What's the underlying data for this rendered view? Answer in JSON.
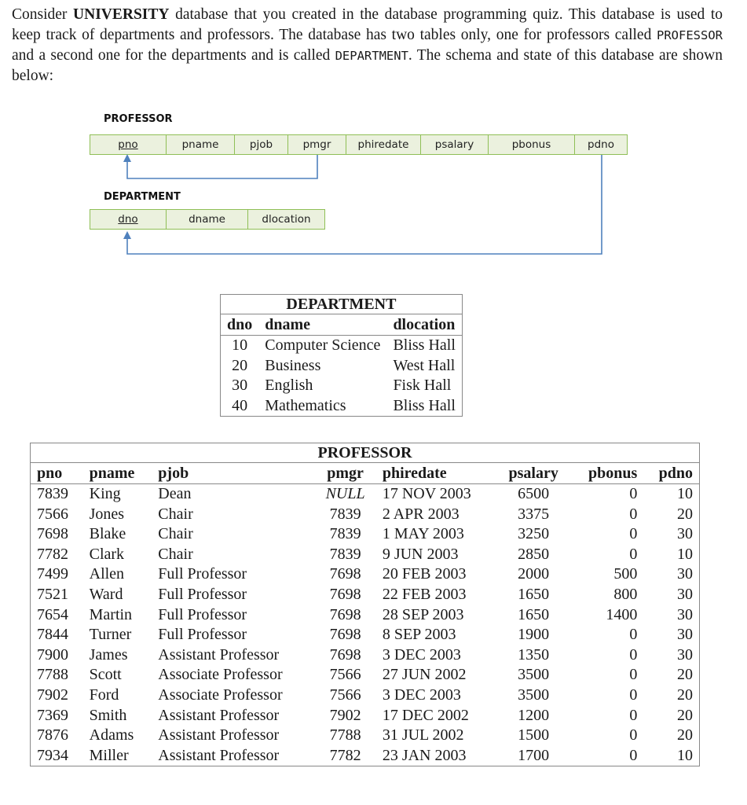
{
  "intro": {
    "p1": "Consider ",
    "db_name": "UNIVERSITY",
    "p2": " database that you created in the database programming quiz. This database is used to keep track of departments and professors. The database has two tables only, one for professors called ",
    "tbl1": "PROFESSOR",
    "p3": " and a second one for the departments and is called ",
    "tbl2": "DEPARTMENT",
    "p4": ". The schema and state of this database are shown below:"
  },
  "schema": {
    "professor": {
      "label": "PROFESSOR",
      "attributes": [
        "pno",
        "pname",
        "pjob",
        "pmgr",
        "phiredate",
        "psalary",
        "pbonus",
        "pdno"
      ],
      "primary_key": "pno"
    },
    "department": {
      "label": "DEPARTMENT",
      "attributes": [
        "dno",
        "dname",
        "dlocation"
      ],
      "primary_key": "dno"
    },
    "foreign_keys": [
      {
        "from": "PROFESSOR.pmgr",
        "to": "PROFESSOR.pno"
      },
      {
        "from": "PROFESSOR.pdno",
        "to": "DEPARTMENT.dno"
      }
    ],
    "colors": {
      "cell_fill": "#ebf1de",
      "cell_border": "#8fbf56",
      "arrow": "#4f81bd"
    }
  },
  "department_table": {
    "title": "DEPARTMENT",
    "columns": [
      "dno",
      "dname",
      "dlocation"
    ],
    "rows": [
      [
        "10",
        "Computer Science",
        "Bliss Hall"
      ],
      [
        "20",
        "Business",
        "West Hall"
      ],
      [
        "30",
        "English",
        "Fisk Hall"
      ],
      [
        "40",
        "Mathematics",
        "Bliss Hall"
      ]
    ]
  },
  "professor_table": {
    "title": "PROFESSOR",
    "columns": [
      "pno",
      "pname",
      "pjob",
      "pmgr",
      "phiredate",
      "psalary",
      "pbonus",
      "pdno"
    ],
    "rows": [
      [
        "7839",
        "King",
        "Dean",
        "NULL",
        "17 NOV 2003",
        "6500",
        "0",
        "10"
      ],
      [
        "7566",
        "Jones",
        "Chair",
        "7839",
        "2 APR 2003",
        "3375",
        "0",
        "20"
      ],
      [
        "7698",
        "Blake",
        "Chair",
        "7839",
        "1 MAY 2003",
        "3250",
        "0",
        "30"
      ],
      [
        "7782",
        "Clark",
        "Chair",
        "7839",
        "9 JUN 2003",
        "2850",
        "0",
        "10"
      ],
      [
        "7499",
        "Allen",
        "Full Professor",
        "7698",
        "20 FEB 2003",
        "2000",
        "500",
        "30"
      ],
      [
        "7521",
        "Ward",
        "Full Professor",
        "7698",
        "22 FEB 2003",
        "1650",
        "800",
        "30"
      ],
      [
        "7654",
        "Martin",
        "Full Professor",
        "7698",
        "28 SEP 2003",
        "1650",
        "1400",
        "30"
      ],
      [
        "7844",
        "Turner",
        "Full Professor",
        "7698",
        "8 SEP 2003",
        "1900",
        "0",
        "30"
      ],
      [
        "7900",
        "James",
        "Assistant Professor",
        "7698",
        "3 DEC 2003",
        "1350",
        "0",
        "30"
      ],
      [
        "7788",
        "Scott",
        "Associate Professor",
        "7566",
        "27 JUN 2002",
        "3500",
        "0",
        "20"
      ],
      [
        "7902",
        "Ford",
        "Associate Professor",
        "7566",
        "3 DEC 2003",
        "3500",
        "0",
        "20"
      ],
      [
        "7369",
        "Smith",
        "Assistant Professor",
        "7902",
        "17 DEC 2002",
        "1200",
        "0",
        "20"
      ],
      [
        "7876",
        "Adams",
        "Assistant Professor",
        "7788",
        "31 JUL 2002",
        "1500",
        "0",
        "20"
      ],
      [
        "7934",
        "Miller",
        "Assistant Professor",
        "7782",
        "23 JAN 2003",
        "1700",
        "0",
        "10"
      ]
    ]
  }
}
